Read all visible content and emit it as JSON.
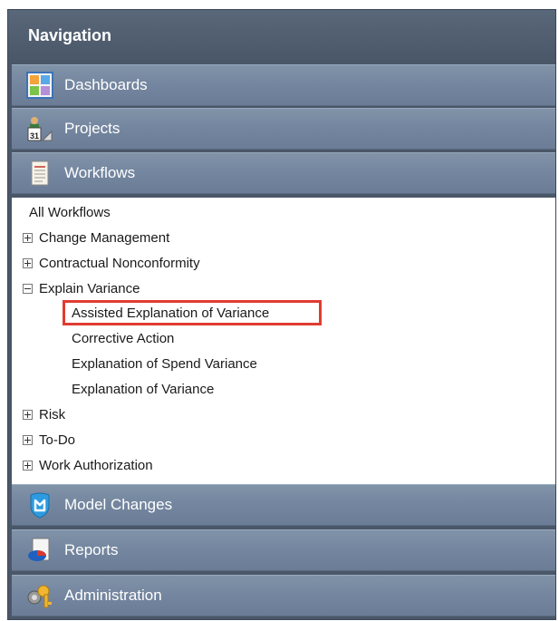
{
  "nav": {
    "title": "Navigation",
    "sections": {
      "dashboards": "Dashboards",
      "projects": "Projects",
      "workflows": "Workflows",
      "model_changes": "Model Changes",
      "reports": "Reports",
      "administration": "Administration"
    },
    "tree": {
      "all_workflows": "All Workflows",
      "change_management": "Change Management",
      "contractual_nonconformity": "Contractual Nonconformity",
      "explain_variance": "Explain Variance",
      "explain_children": [
        "Assisted Explanation of Variance",
        "Corrective Action",
        "Explanation of Spend Variance",
        "Explanation of Variance"
      ],
      "risk": "Risk",
      "todo": "To-Do",
      "work_authorization": "Work Authorization"
    },
    "calendar_day": "31",
    "highlight_color": "#e03c31"
  }
}
